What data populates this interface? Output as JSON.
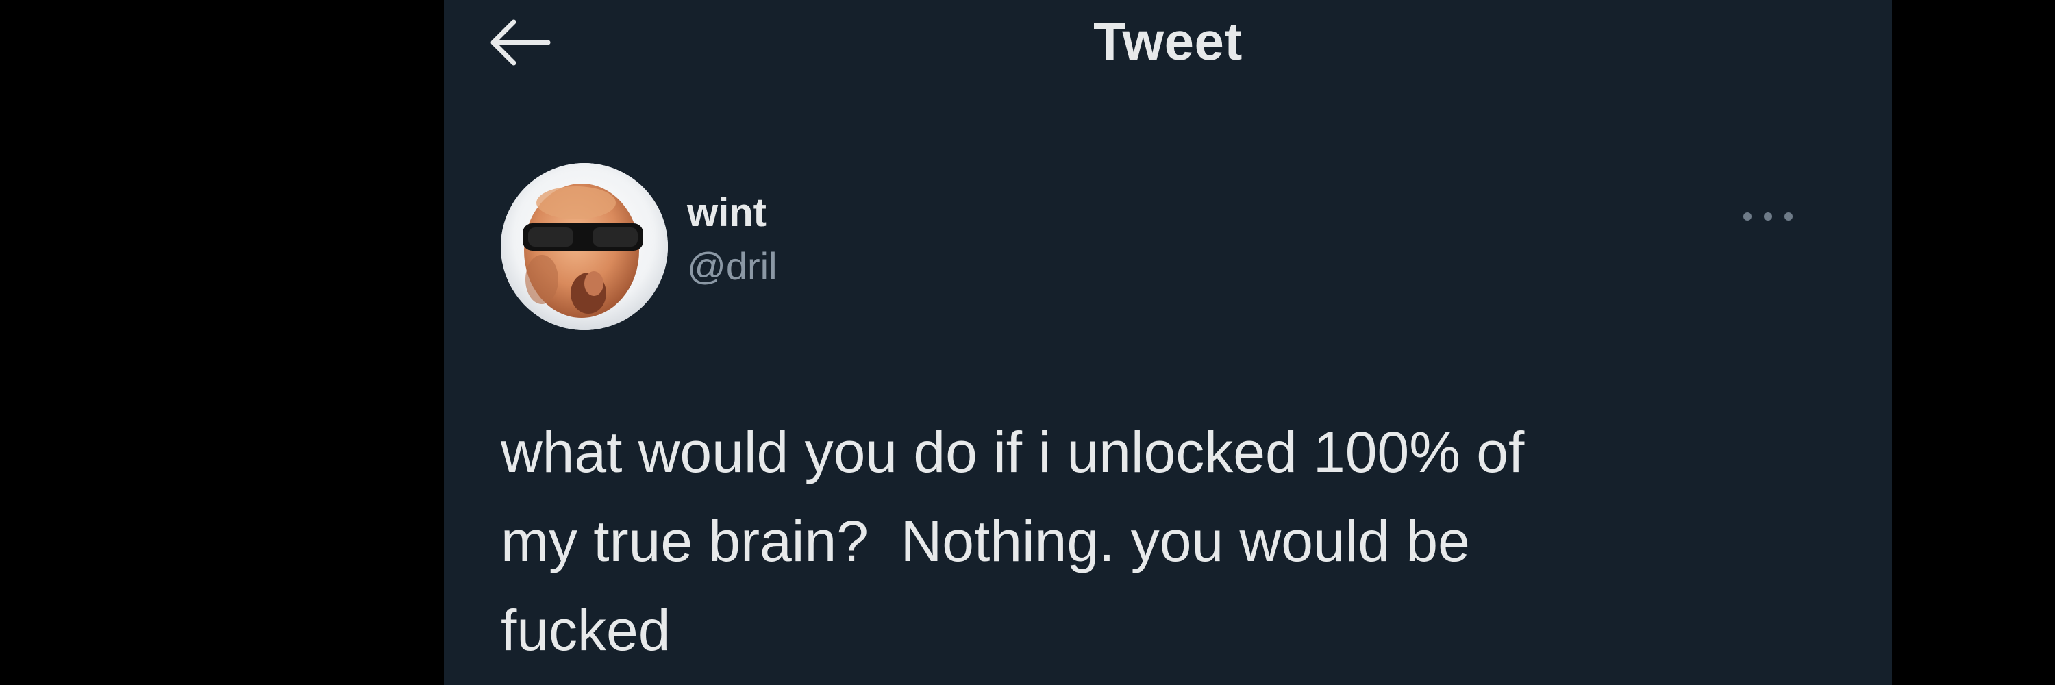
{
  "header": {
    "title": "Tweet",
    "back_icon": "arrow-left-icon"
  },
  "tweet": {
    "author_name": "wint",
    "author_handle": "@dril",
    "more_icon": "more-horizontal-icon",
    "text_lines": [
      "what would you do if i unlocked 100% of",
      "my true brain?  Nothing. you would be",
      "fucked"
    ]
  },
  "colors": {
    "background": "#15202b",
    "outer": "#000000",
    "text_primary": "#e7e9ea",
    "text_secondary": "#8b98a5"
  }
}
